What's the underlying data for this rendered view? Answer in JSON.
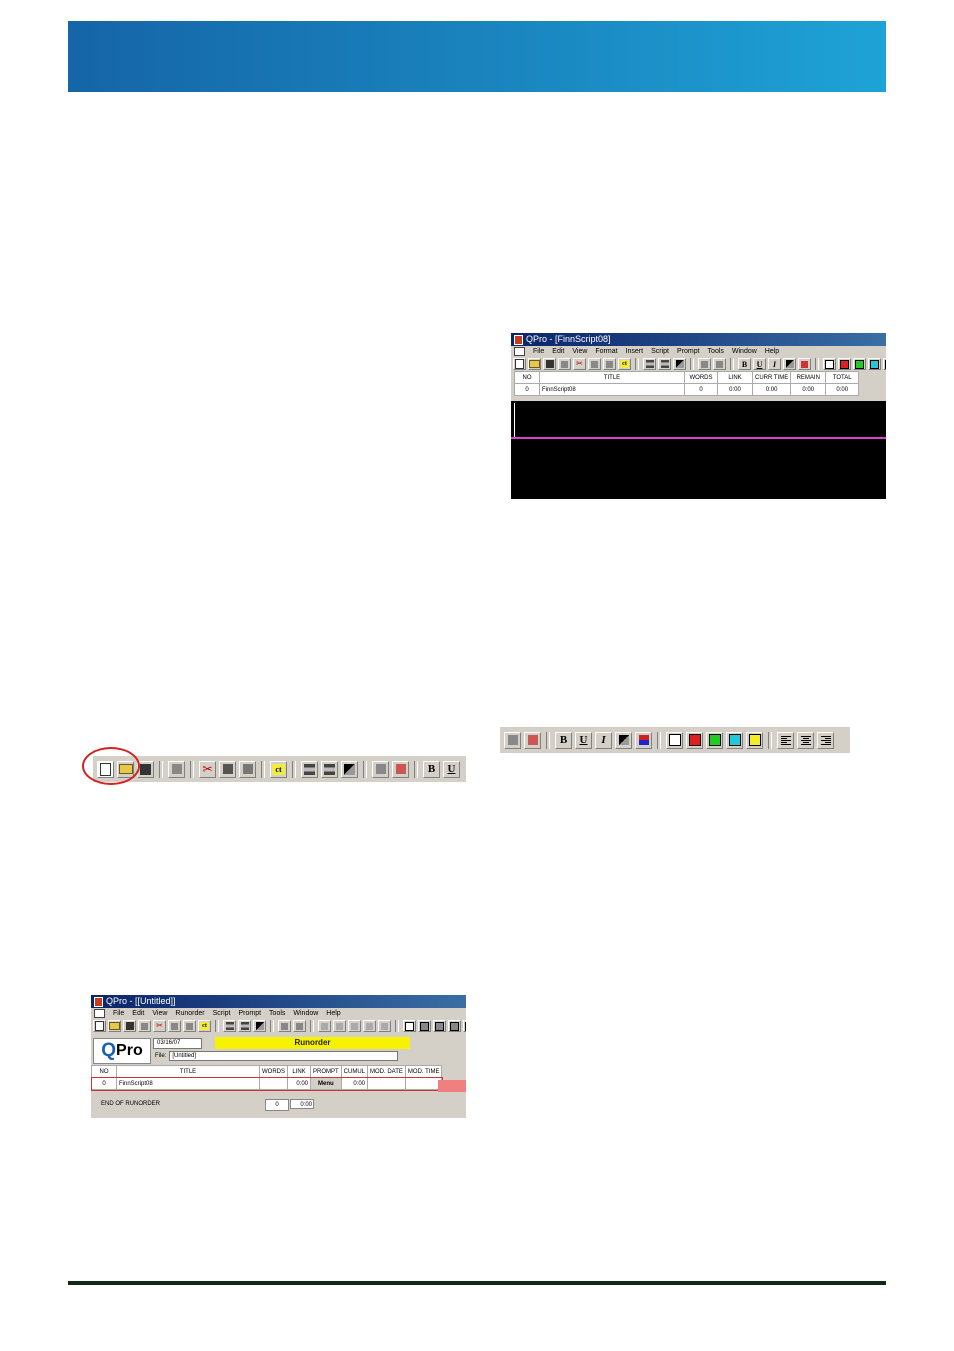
{
  "colors": {
    "header_band": "#1a86c0",
    "footer_rule": "#0f2a17",
    "runorder_bar": "#f7f200",
    "swatches": [
      "#ffffff",
      "#e02020",
      "#22cc22",
      "#22c8d8",
      "#f2ec2a"
    ]
  },
  "shot1": {
    "title": "QPro - [FinnScript08]",
    "menu": [
      "File",
      "Edit",
      "View",
      "Format",
      "Insert",
      "Script",
      "Prompt",
      "Tools",
      "Window",
      "Help"
    ],
    "columns": [
      "NO",
      "TITLE",
      "WORDS",
      "LINK",
      "CURR TIME",
      "REMAIN",
      "TOTAL"
    ],
    "row": [
      "0",
      "FinnScript08",
      "0",
      "0:00",
      "0:00",
      "0:00",
      "0:00"
    ]
  },
  "stripB": {
    "bold": "B",
    "underline": "U",
    "italic": "I"
  },
  "stripA": {
    "bold": "B",
    "underline": "U",
    "icon_names": [
      "new-file-icon",
      "open-file-icon",
      "save-icon",
      "save-grey-icon",
      "cut-icon",
      "copy-icon",
      "paste-icon",
      "control-icon",
      "prompt-icon",
      "prompt-edit-icon",
      "tool-icon",
      "view-icon",
      "view-edit-icon"
    ]
  },
  "shot2": {
    "title": "QPro - [[Untitled]]",
    "menu": [
      "File",
      "Edit",
      "View",
      "Runorder",
      "Script",
      "Prompt",
      "Tools",
      "Window",
      "Help"
    ],
    "logo_q": "Q",
    "logo_rest": "Pro",
    "date": "03/16/07",
    "runorder": "Runorder",
    "file_label": "File:",
    "file_value": "[Untitled]",
    "columns": [
      "NO",
      "TITLE",
      "WORDS",
      "LINK",
      "PROMPT",
      "CUMUL",
      "MOD. DATE",
      "MOD. TIME"
    ],
    "row": [
      "0",
      "FinnScript08",
      "",
      "0:00",
      "Menu",
      "0:00",
      "",
      ""
    ],
    "end_label": "END OF RUNORDER",
    "end_words": "0",
    "end_time": "0:00"
  }
}
